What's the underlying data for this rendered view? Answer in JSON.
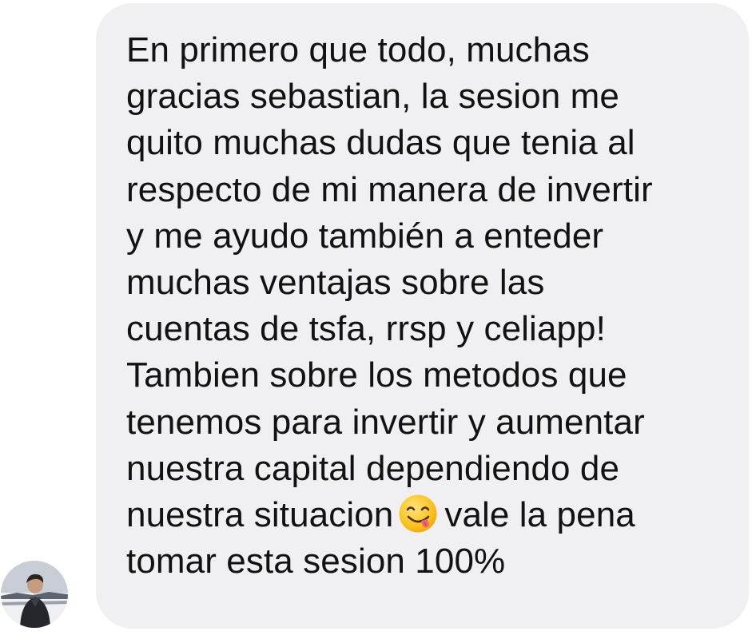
{
  "conversation": {
    "sender_avatar_icon": "user-avatar-photo",
    "message": {
      "lines": [
        "En primero que todo, muchas",
        "gracias sebastian, la sesion me",
        "quito muchas dudas que tenia al",
        "respecto de mi manera de invertir",
        "y me ayudo también a enteder",
        "muchas ventajas sobre las",
        "cuentas de tsfa, rrsp y celiapp!",
        "Tambien sobre los metodos que",
        "tenemos para invertir y aumentar",
        "nuestra capital dependiendo de"
      ],
      "line11_before_emoji": "nuestra situacion",
      "emoji": "face-savoring-food-emoji",
      "line11_after_emoji": "vale la pena",
      "line12": "tomar esta sesion 100%"
    },
    "colors": {
      "bubble_background": "#f0f0f2",
      "text": "#121212",
      "page_background": "#ffffff"
    }
  }
}
